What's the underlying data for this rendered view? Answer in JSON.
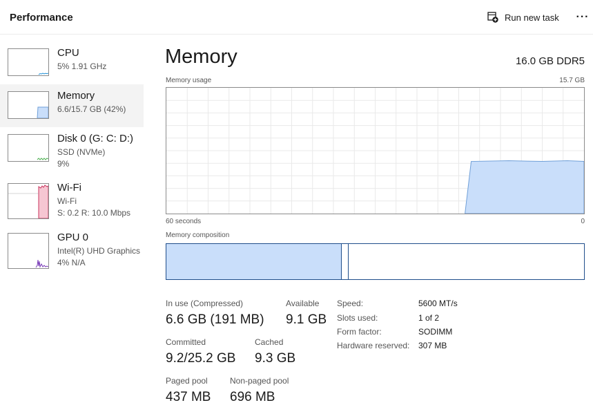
{
  "header": {
    "title": "Performance",
    "run_task_label": "Run new task",
    "more_label": "···"
  },
  "sidebar": {
    "items": [
      {
        "name": "CPU",
        "sub1": "5%  1.91 GHz",
        "sub2": "",
        "usage_pct": 5
      },
      {
        "name": "Memory",
        "sub1": "6.6/15.7 GB (42%)",
        "sub2": "",
        "usage_pct": 42,
        "selected": true
      },
      {
        "name": "Disk 0 (G: C: D:)",
        "sub1": "SSD (NVMe)",
        "sub2": "9%",
        "usage_pct": 9
      },
      {
        "name": "Wi-Fi",
        "sub1": "Wi-Fi",
        "sub2": "S: 0.2  R: 10.0 Mbps"
      },
      {
        "name": "GPU 0",
        "sub1": "Intel(R) UHD Graphics",
        "sub2": "4%  N/A",
        "usage_pct": 4
      }
    ]
  },
  "main": {
    "title": "Memory",
    "spec": "16.0 GB DDR5",
    "usage_chart": {
      "label": "Memory usage",
      "max_label": "15.7 GB",
      "time_label": "60 seconds",
      "zero_label": "0"
    },
    "composition": {
      "label": "Memory composition",
      "in_use_fraction": 0.42,
      "modified_fraction": 0.016
    },
    "stats": {
      "in_use_label": "In use (Compressed)",
      "in_use_value": "6.6 GB (191 MB)",
      "available_label": "Available",
      "available_value": "9.1 GB",
      "committed_label": "Committed",
      "committed_value": "9.2/25.2 GB",
      "cached_label": "Cached",
      "cached_value": "9.3 GB",
      "paged_pool_label": "Paged pool",
      "paged_pool_value": "437 MB",
      "nonpaged_pool_label": "Non-paged pool",
      "nonpaged_pool_value": "696 MB"
    },
    "specs": {
      "speed_label": "Speed:",
      "speed_value": "5600 MT/s",
      "slots_label": "Slots used:",
      "slots_value": "1 of 2",
      "form_label": "Form factor:",
      "form_value": "SODIMM",
      "reserved_label": "Hardware reserved:",
      "reserved_value": "307 MB"
    }
  },
  "colors": {
    "memory_fill": "#c9defa",
    "memory_stroke": "#1e4d8a",
    "memory_line": "#6f9fd8",
    "cpu_line": "#1e8fd6",
    "disk_line": "#4caf50",
    "wifi_fill": "#f6c6d2",
    "wifi_line": "#c8325c",
    "gpu_line": "#7a3db8",
    "grid": "#e9e9e9"
  }
}
